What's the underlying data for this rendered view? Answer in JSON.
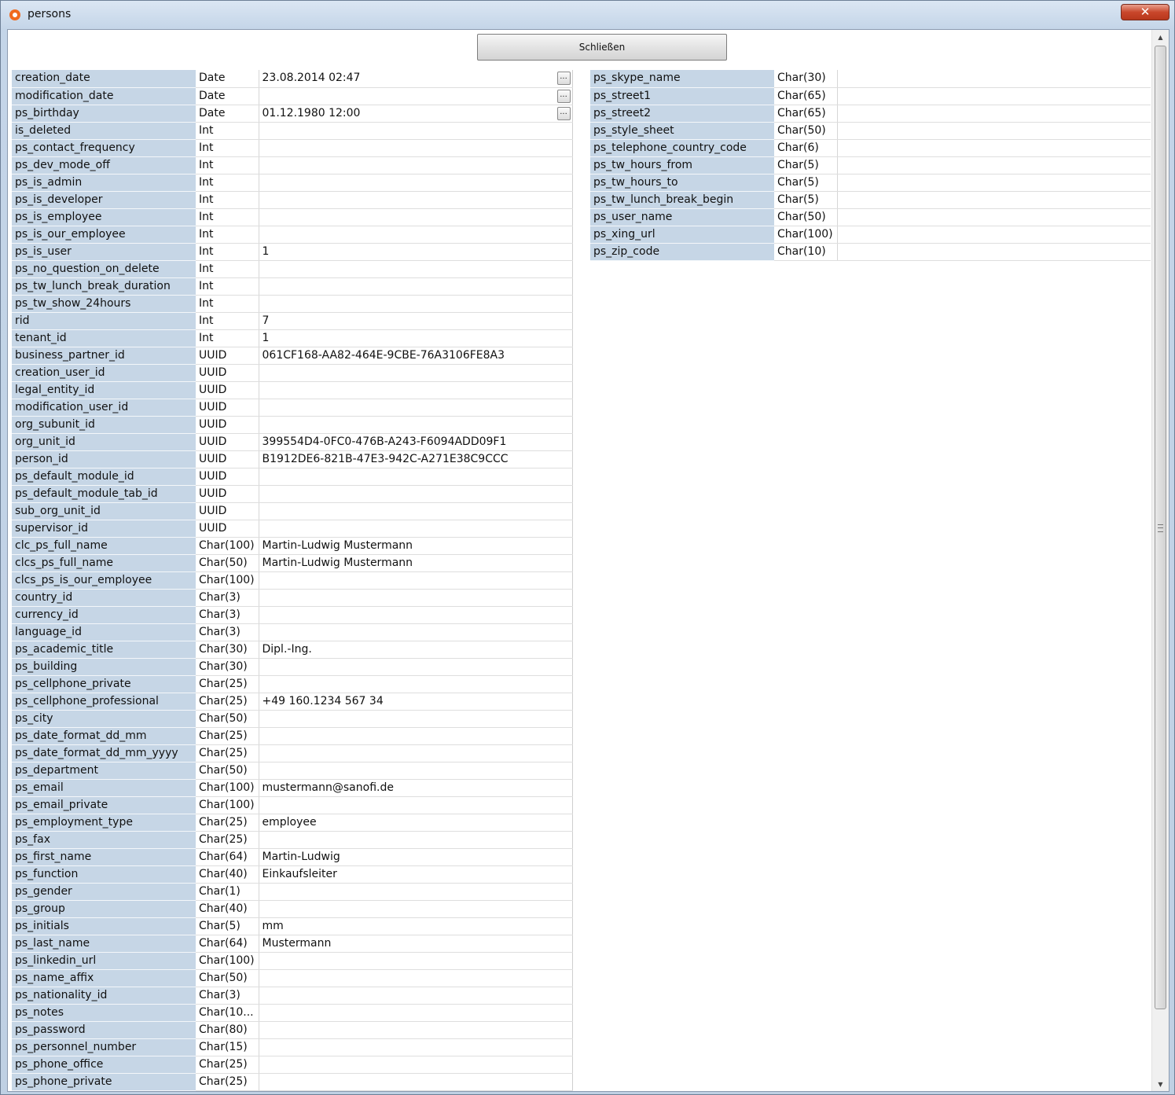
{
  "window": {
    "title": "persons",
    "close_glyph": "✕"
  },
  "toolbar": {
    "close_label": "Schließen"
  },
  "picker_glyph": "...",
  "left_fields": [
    {
      "name": "creation_date",
      "type": "Date",
      "value": "23.08.2014 02:47",
      "picker": true
    },
    {
      "name": "modification_date",
      "type": "Date",
      "value": "",
      "picker": true
    },
    {
      "name": "ps_birthday",
      "type": "Date",
      "value": "01.12.1980 12:00",
      "picker": true
    },
    {
      "name": "is_deleted",
      "type": "Int",
      "value": ""
    },
    {
      "name": "ps_contact_frequency",
      "type": "Int",
      "value": ""
    },
    {
      "name": "ps_dev_mode_off",
      "type": "Int",
      "value": ""
    },
    {
      "name": "ps_is_admin",
      "type": "Int",
      "value": ""
    },
    {
      "name": "ps_is_developer",
      "type": "Int",
      "value": ""
    },
    {
      "name": "ps_is_employee",
      "type": "Int",
      "value": ""
    },
    {
      "name": "ps_is_our_employee",
      "type": "Int",
      "value": ""
    },
    {
      "name": "ps_is_user",
      "type": "Int",
      "value": "1"
    },
    {
      "name": "ps_no_question_on_delete",
      "type": "Int",
      "value": ""
    },
    {
      "name": "ps_tw_lunch_break_duration",
      "type": "Int",
      "value": ""
    },
    {
      "name": "ps_tw_show_24hours",
      "type": "Int",
      "value": ""
    },
    {
      "name": "rid",
      "type": "Int",
      "value": "7"
    },
    {
      "name": "tenant_id",
      "type": "Int",
      "value": "1"
    },
    {
      "name": "business_partner_id",
      "type": "UUID",
      "value": "061CF168-AA82-464E-9CBE-76A3106FE8A3"
    },
    {
      "name": "creation_user_id",
      "type": "UUID",
      "value": ""
    },
    {
      "name": "legal_entity_id",
      "type": "UUID",
      "value": ""
    },
    {
      "name": "modification_user_id",
      "type": "UUID",
      "value": ""
    },
    {
      "name": "org_subunit_id",
      "type": "UUID",
      "value": ""
    },
    {
      "name": "org_unit_id",
      "type": "UUID",
      "value": "399554D4-0FC0-476B-A243-F6094ADD09F1"
    },
    {
      "name": "person_id",
      "type": "UUID",
      "value": "B1912DE6-821B-47E3-942C-A271E38C9CCC"
    },
    {
      "name": "ps_default_module_id",
      "type": "UUID",
      "value": ""
    },
    {
      "name": "ps_default_module_tab_id",
      "type": "UUID",
      "value": ""
    },
    {
      "name": "sub_org_unit_id",
      "type": "UUID",
      "value": ""
    },
    {
      "name": "supervisor_id",
      "type": "UUID",
      "value": ""
    },
    {
      "name": "clc_ps_full_name",
      "type": "Char(100)",
      "value": "Martin-Ludwig Mustermann"
    },
    {
      "name": "clcs_ps_full_name",
      "type": "Char(50)",
      "value": "Martin-Ludwig Mustermann"
    },
    {
      "name": "clcs_ps_is_our_employee",
      "type": "Char(100)",
      "value": ""
    },
    {
      "name": "country_id",
      "type": "Char(3)",
      "value": ""
    },
    {
      "name": "currency_id",
      "type": "Char(3)",
      "value": ""
    },
    {
      "name": "language_id",
      "type": "Char(3)",
      "value": ""
    },
    {
      "name": "ps_academic_title",
      "type": "Char(30)",
      "value": "Dipl.-Ing."
    },
    {
      "name": "ps_building",
      "type": "Char(30)",
      "value": ""
    },
    {
      "name": "ps_cellphone_private",
      "type": "Char(25)",
      "value": ""
    },
    {
      "name": "ps_cellphone_professional",
      "type": "Char(25)",
      "value": "+49 160.1234 567 34"
    },
    {
      "name": "ps_city",
      "type": "Char(50)",
      "value": ""
    },
    {
      "name": "ps_date_format_dd_mm",
      "type": "Char(25)",
      "value": ""
    },
    {
      "name": "ps_date_format_dd_mm_yyyy",
      "type": "Char(25)",
      "value": ""
    },
    {
      "name": "ps_department",
      "type": "Char(50)",
      "value": ""
    },
    {
      "name": "ps_email",
      "type": "Char(100)",
      "value": "mustermann@sanofi.de"
    },
    {
      "name": "ps_email_private",
      "type": "Char(100)",
      "value": ""
    },
    {
      "name": "ps_employment_type",
      "type": "Char(25)",
      "value": "employee"
    },
    {
      "name": "ps_fax",
      "type": "Char(25)",
      "value": ""
    },
    {
      "name": "ps_first_name",
      "type": "Char(64)",
      "value": "Martin-Ludwig"
    },
    {
      "name": "ps_function",
      "type": "Char(40)",
      "value": "Einkaufsleiter"
    },
    {
      "name": "ps_gender",
      "type": "Char(1)",
      "value": ""
    },
    {
      "name": "ps_group",
      "type": "Char(40)",
      "value": ""
    },
    {
      "name": "ps_initials",
      "type": "Char(5)",
      "value": "mm"
    },
    {
      "name": "ps_last_name",
      "type": "Char(64)",
      "value": "Mustermann"
    },
    {
      "name": "ps_linkedin_url",
      "type": "Char(100)",
      "value": ""
    },
    {
      "name": "ps_name_affix",
      "type": "Char(50)",
      "value": ""
    },
    {
      "name": "ps_nationality_id",
      "type": "Char(3)",
      "value": ""
    },
    {
      "name": "ps_notes",
      "type": "Char(10...",
      "value": ""
    },
    {
      "name": "ps_password",
      "type": "Char(80)",
      "value": ""
    },
    {
      "name": "ps_personnel_number",
      "type": "Char(15)",
      "value": ""
    },
    {
      "name": "ps_phone_office",
      "type": "Char(25)",
      "value": ""
    },
    {
      "name": "ps_phone_private",
      "type": "Char(25)",
      "value": ""
    }
  ],
  "right_fields": [
    {
      "name": "ps_skype_name",
      "type": "Char(30)",
      "value": ""
    },
    {
      "name": "ps_street1",
      "type": "Char(65)",
      "value": ""
    },
    {
      "name": "ps_street2",
      "type": "Char(65)",
      "value": ""
    },
    {
      "name": "ps_style_sheet",
      "type": "Char(50)",
      "value": ""
    },
    {
      "name": "ps_telephone_country_code",
      "type": "Char(6)",
      "value": ""
    },
    {
      "name": "ps_tw_hours_from",
      "type": "Char(5)",
      "value": ""
    },
    {
      "name": "ps_tw_hours_to",
      "type": "Char(5)",
      "value": ""
    },
    {
      "name": "ps_tw_lunch_break_begin",
      "type": "Char(5)",
      "value": ""
    },
    {
      "name": "ps_user_name",
      "type": "Char(50)",
      "value": ""
    },
    {
      "name": "ps_xing_url",
      "type": "Char(100)",
      "value": ""
    },
    {
      "name": "ps_zip_code",
      "type": "Char(10)",
      "value": ""
    }
  ],
  "scrollbar": {
    "up_glyph": "▲",
    "down_glyph": "▼"
  }
}
